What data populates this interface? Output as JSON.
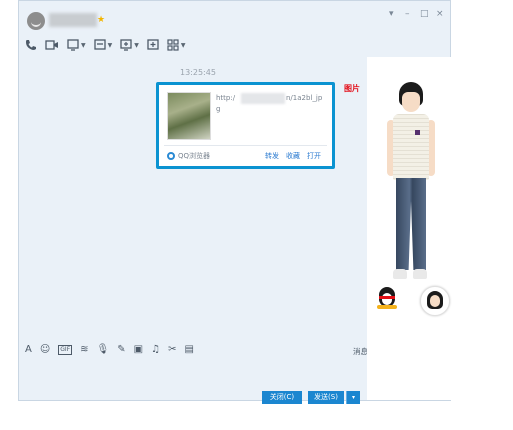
{
  "window": {
    "controls": {
      "menu": "▾",
      "minimize": "–",
      "maximize": "□",
      "close": "×"
    }
  },
  "toolbar": {
    "icons": [
      "phone-icon",
      "video-call-icon",
      "screen-share-icon",
      "remote-assist-icon",
      "file-transfer-icon",
      "new-group-icon",
      "apps-icon"
    ]
  },
  "chat": {
    "timestamp": "13:25:45",
    "link_card": {
      "url_prefix": "http:/",
      "url_suffix": "n/1a2bl_jp",
      "url_tail": "g",
      "browser_label": "QQ浏览器",
      "actions": [
        "转发",
        "收藏",
        "打开"
      ]
    },
    "image_badge": "图片"
  },
  "input_toolbar": {
    "icons": [
      "A",
      "☺",
      "GIF",
      "≋",
      "🎙",
      "✎",
      "▣",
      "♫",
      "✂",
      "▤"
    ],
    "history_label": "消息记录▾"
  },
  "buttons": {
    "close": "关闭(C)",
    "send": "发送(S)",
    "send_more": "▾"
  },
  "colors": {
    "accent": "#0b93d1",
    "button": "#1b86d0",
    "window_bg": "#eaf1f8"
  }
}
